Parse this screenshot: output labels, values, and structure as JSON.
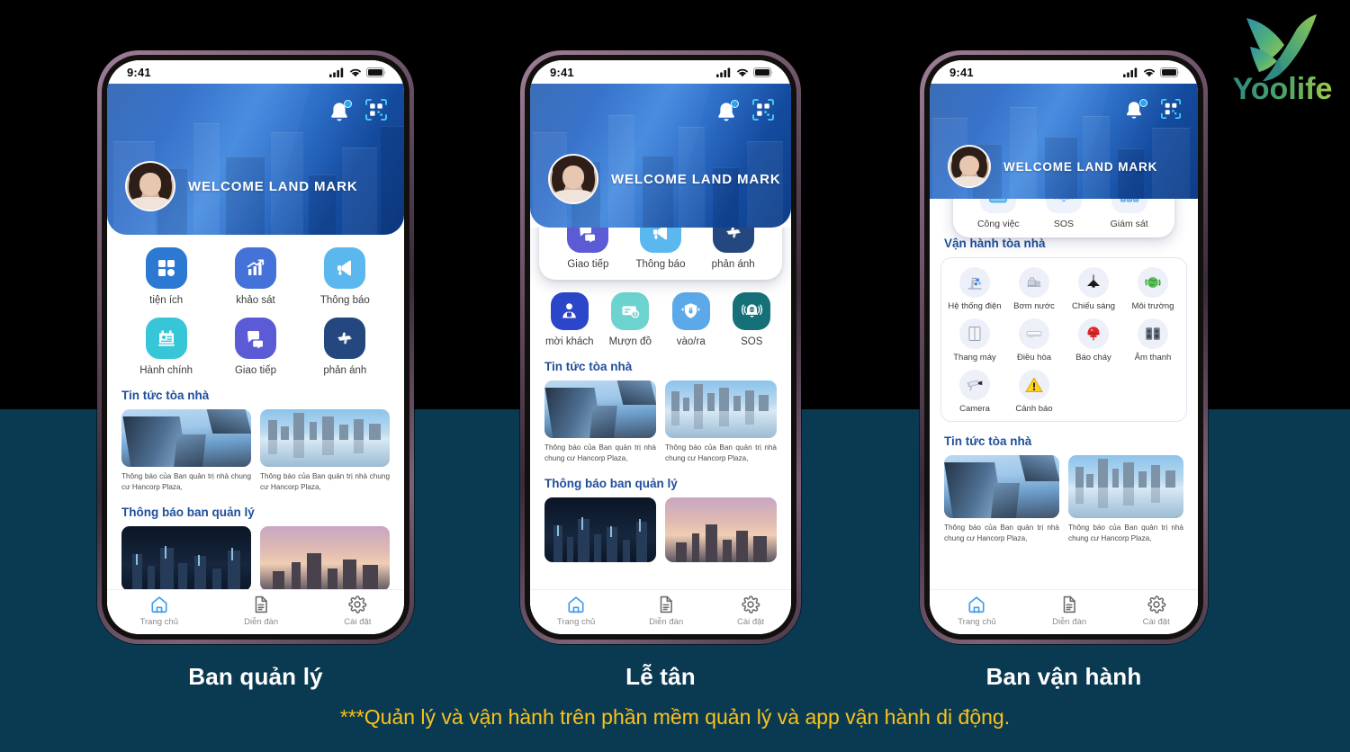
{
  "brand": {
    "logo_text": "Yoolife",
    "logo_mark": "bird-y-mark",
    "colors": {
      "primary_green": "#3FA06A",
      "teal": "#2E8C8C",
      "light_green": "#9BC94E"
    }
  },
  "background": {
    "top_color": "#000000",
    "bottom_color": "#0A3A52"
  },
  "status_bar": {
    "time": "9:41",
    "icons": [
      "cellular-signal-icon",
      "wifi-icon",
      "battery-icon"
    ]
  },
  "header": {
    "welcome": "WELCOME LAND MARK",
    "bell_icon": "notification-bell-icon",
    "qr_icon": "qr-scan-icon",
    "avatar": "user-avatar"
  },
  "tabbar": {
    "items": [
      {
        "label": "Trang chủ",
        "icon": "home-icon",
        "active": true
      },
      {
        "label": "Diễn đàn",
        "icon": "document-icon",
        "active": false
      },
      {
        "label": "Cài đặt",
        "icon": "gear-icon",
        "active": false
      }
    ]
  },
  "news": {
    "title": "Tin tức tòa nhà",
    "items": [
      {
        "caption": "Thông báo của Ban quản trị nhà chung cư Hancorp Plaza,"
      },
      {
        "caption": "Thông báo của Ban quản trị nhà chung cư Hancorp Plaza,"
      }
    ]
  },
  "announcements": {
    "title": "Thông báo ban quản lý"
  },
  "phone1": {
    "caption": "Ban quản lý",
    "apps": [
      {
        "label": "tiện ích",
        "icon": "grid-apps-icon",
        "color": "#2B79D2"
      },
      {
        "label": "khảo sát",
        "icon": "bar-chart-growth-icon",
        "color": "#4572D8"
      },
      {
        "label": "Thông báo",
        "icon": "megaphone-icon",
        "color": "#5AB8EE"
      },
      {
        "label": "Hành chính",
        "icon": "id-card-icon",
        "color": "#37C5D8"
      },
      {
        "label": "Giao tiếp",
        "icon": "chat-bubbles-icon",
        "color": "#5B5BD6"
      },
      {
        "label": "phản ánh",
        "icon": "feedback-hands-icon",
        "color": "#23477E"
      }
    ]
  },
  "phone2": {
    "caption": "Lễ tân",
    "card_apps": [
      {
        "label": "Giao tiếp",
        "icon": "chat-bubbles-icon",
        "color": "#5B5BD6"
      },
      {
        "label": "Thông báo",
        "icon": "megaphone-icon",
        "color": "#5AB8EE"
      },
      {
        "label": "phản ánh",
        "icon": "feedback-hands-icon",
        "color": "#23477E"
      }
    ],
    "apps": [
      {
        "label": "mời khách",
        "icon": "invite-guest-icon",
        "color": "#2B46C8"
      },
      {
        "label": "Mượn đồ",
        "icon": "borrow-card-lock-icon",
        "color": "#6DD3CE"
      },
      {
        "label": "vào/ra",
        "icon": "access-in-out-icon",
        "color": "#5BA9E8"
      },
      {
        "label": "SOS",
        "icon": "sos-alarm-icon",
        "color": "#157078"
      }
    ]
  },
  "phone3": {
    "caption": "Ban vận hành",
    "card_apps": [
      {
        "label": "Công việc",
        "icon": "briefcase-icon"
      },
      {
        "label": "SOS",
        "icon": "sos-alarm-icon"
      },
      {
        "label": "Giám sát",
        "icon": "org-monitor-icon"
      }
    ],
    "ops_title": "Vận hành tòa nhà",
    "ops": [
      {
        "label": "Hệ thống điện",
        "icon": "power-grid-icon"
      },
      {
        "label": "Bơm nước",
        "icon": "water-pump-icon"
      },
      {
        "label": "Chiếu sáng",
        "icon": "pendant-lamp-icon"
      },
      {
        "label": "Môi trường",
        "icon": "environment-globe-icon"
      },
      {
        "label": "Thang máy",
        "icon": "elevator-icon"
      },
      {
        "label": "Điều hòa",
        "icon": "air-conditioner-icon"
      },
      {
        "label": "Báo cháy",
        "icon": "fire-alarm-bell-icon"
      },
      {
        "label": "Âm thanh",
        "icon": "speakers-icon"
      },
      {
        "label": "Camera",
        "icon": "cctv-camera-icon"
      },
      {
        "label": "Cảnh báo",
        "icon": "warning-triangle-icon"
      }
    ]
  },
  "footnote": "***Quản lý và vận hành trên phần mềm quản lý và app vận hành di động."
}
